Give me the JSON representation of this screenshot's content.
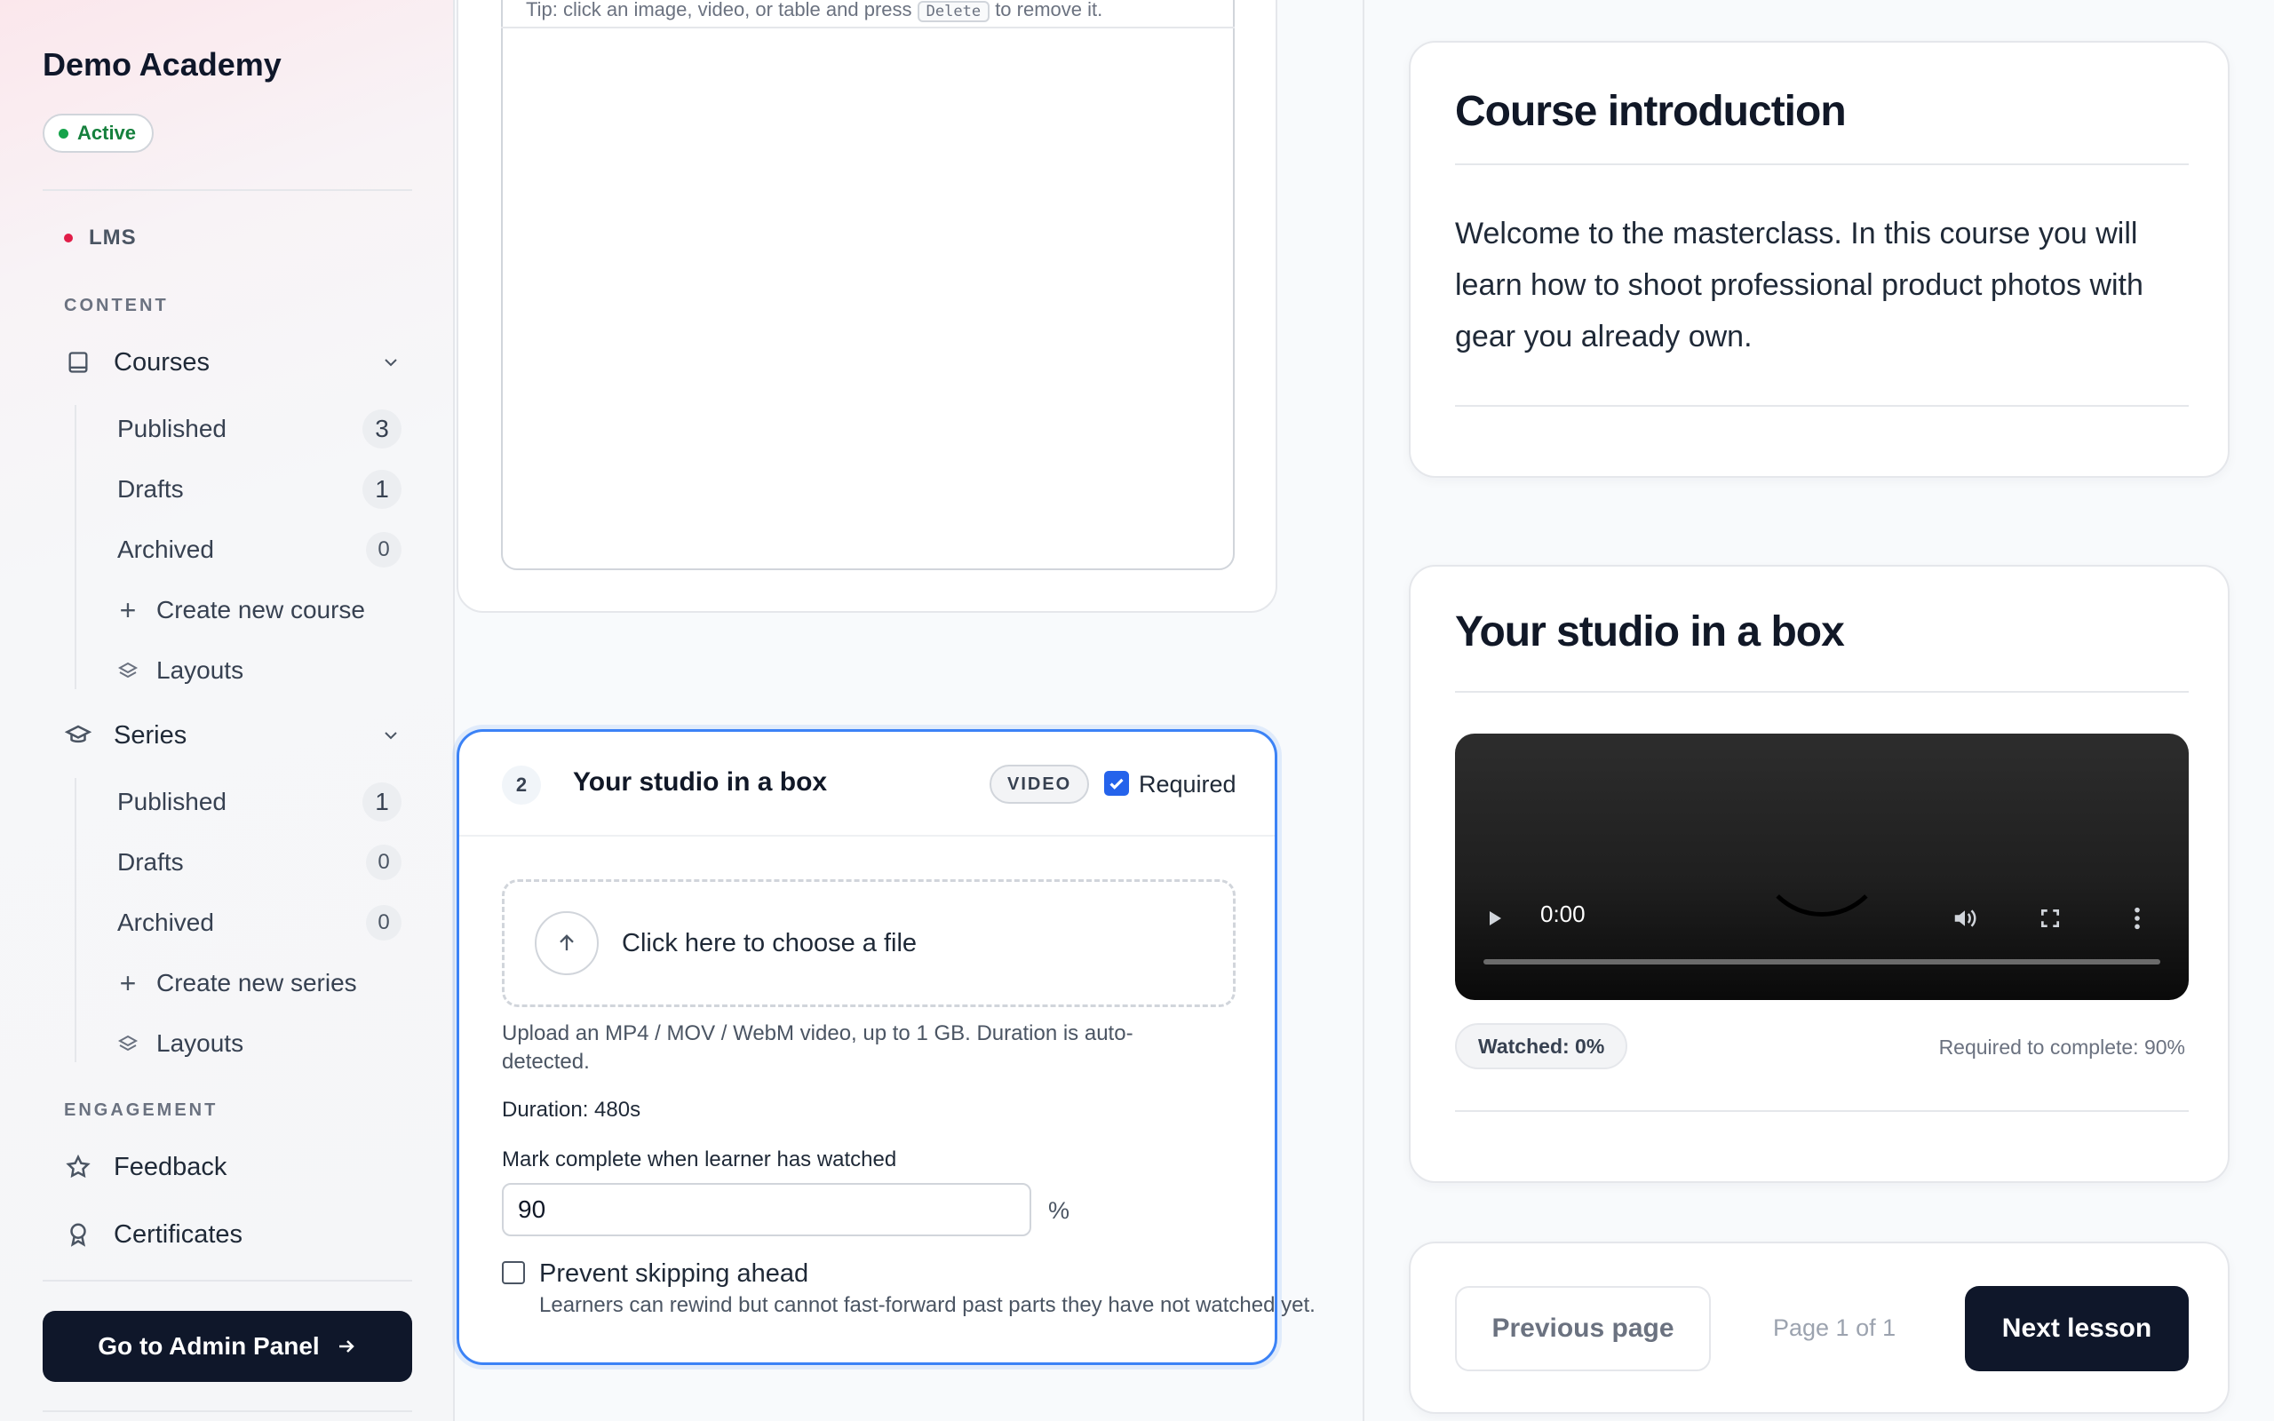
{
  "sidebar": {
    "brand": "Demo Academy",
    "status": "Active",
    "lms_label": "LMS",
    "content_label": "CONTENT",
    "engagement_label": "ENGAGEMENT",
    "courses": {
      "label": "Courses",
      "published": {
        "label": "Published",
        "count": "3"
      },
      "drafts": {
        "label": "Drafts",
        "count": "1"
      },
      "archived": {
        "label": "Archived",
        "count": "0"
      },
      "create": "Create new course",
      "layouts": "Layouts"
    },
    "series": {
      "label": "Series",
      "published": {
        "label": "Published",
        "count": "1"
      },
      "drafts": {
        "label": "Drafts",
        "count": "0"
      },
      "archived": {
        "label": "Archived",
        "count": "0"
      },
      "create": "Create new series",
      "layouts": "Layouts"
    },
    "feedback": "Feedback",
    "certificates": "Certificates",
    "admin_button": "Go to Admin Panel"
  },
  "editor": {
    "tip_before": "Tip: click an image, video, or table and press",
    "tip_key": "Delete",
    "tip_after": "to remove it.",
    "lesson": {
      "number": "2",
      "title": "Your studio in a box",
      "type": "VIDEO",
      "required_label": "Required",
      "required": true,
      "dropzone_text": "Click here to choose a file",
      "help": "Upload an MP4 / MOV / WebM video, up to 1 GB. Duration is auto-detected.",
      "duration": "Duration: 480s",
      "mark_complete_label": "Mark complete when learner has watched",
      "mark_complete_value": "90",
      "percent_sign": "%",
      "skip_label": "Prevent skipping ahead",
      "skip_checked": false,
      "skip_help": "Learners can rewind but cannot fast-forward past parts they have not watched yet."
    }
  },
  "preview": {
    "intro": {
      "title": "Course introduction",
      "body": "Welcome to the masterclass. In this course you will learn how to shoot professional product photos with gear you already own."
    },
    "video_lesson": {
      "title": "Your studio in a box",
      "time": "0:00",
      "watched": "Watched: 0%",
      "required": "Required to complete: 90%"
    },
    "pagination": {
      "previous": "Previous page",
      "indicator": "Page 1 of 1",
      "next": "Next lesson"
    }
  },
  "colors": {
    "accent": "#2563eb",
    "dark": "#0f172a",
    "active_green": "#16a34a",
    "lms_dot": "#e11d48"
  }
}
